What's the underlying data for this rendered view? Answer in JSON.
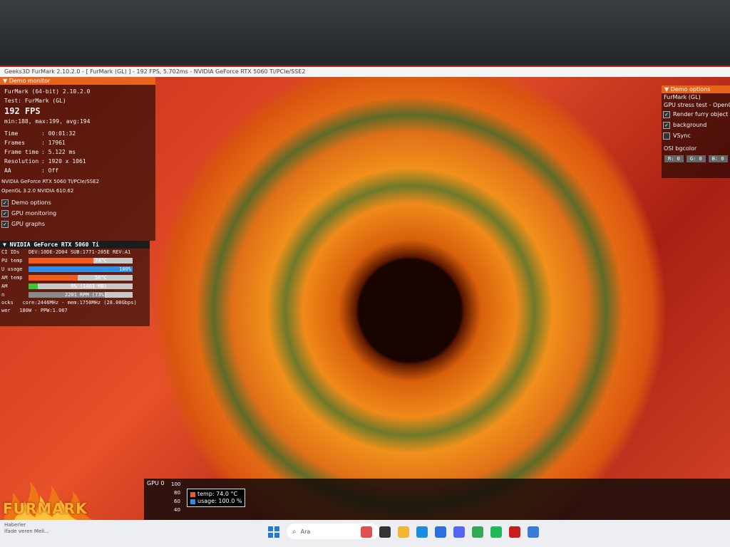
{
  "window": {
    "title": "Geeks3D FurMark 2.10.2.0 - [ FurMark (GL) ] - 192 FPS, 5.702ms - NVIDIA GeForce RTX 5060 Ti/PCIe/SSE2"
  },
  "demo_monitor": {
    "header": "Demo monitor",
    "app": "FurMark (64-bit) 2.10.2.0",
    "test": "Test: FurMark (GL)",
    "fps": "192 FPS",
    "fps_stats": "min:188, max:199, avg:194",
    "stats": [
      {
        "label": "Time",
        "value": ": 00:01:32"
      },
      {
        "label": "Frames",
        "value": ": 17961"
      },
      {
        "label": "Frame time",
        "value": ": 5.122 ms"
      },
      {
        "label": "Resolution",
        "value": ": 1920 x 1061"
      },
      {
        "label": "AA",
        "value": ": Off"
      }
    ],
    "renderer": "NVIDIA GeForce RTX 5060 Ti/PCIe/SSE2",
    "opengl": "OpenGL 3.2.0 NVIDIA 610.62",
    "options": [
      {
        "label": "Demo options",
        "checked": true
      },
      {
        "label": "GPU monitoring",
        "checked": true
      },
      {
        "label": "GPU graphs",
        "checked": true
      }
    ]
  },
  "gpu_monitor": {
    "header": "NVIDIA GeForce RTX 5060 Ti",
    "pci": "DEV:10DE-2D04 SUB:1771-205E REV:A1",
    "pci_label": "CI IDs",
    "rows": [
      {
        "label": "PU temp",
        "text": "74°C",
        "fraction": 0.62,
        "color": "#f05a1e"
      },
      {
        "label": "U usage",
        "text": "100%",
        "fraction": 1.0,
        "color": "#2f8fe6"
      },
      {
        "label": "AM temp",
        "text": "56°C",
        "fraction": 0.47,
        "color": "#f05a1e"
      },
      {
        "label": "AM",
        "text": "9% (1461 MB)",
        "fraction": 0.09,
        "color": "#3cc43c"
      },
      {
        "label": "n",
        "text": "2201 RPM (73%)",
        "fraction": 0.73,
        "color": "#8a8a8a"
      }
    ],
    "clocks_label": "ocks",
    "clocks": "core:2446MHz - mem:1750MHz (28.00Gbps)",
    "power_label": "wer",
    "power": "180W - PPW:1.067"
  },
  "demo_options": {
    "header": "Demo options",
    "api": "FurMark (GL)",
    "subtitle": "GPU stress test - OpenGL 3",
    "checks": [
      {
        "label": "Render furry object",
        "checked": true
      },
      {
        "label": "background",
        "checked": true
      },
      {
        "label": "VSync",
        "checked": false
      }
    ],
    "osi_label": "OSI bgcolor",
    "rgb": [
      "R: 0",
      "G: 0",
      "B: 0"
    ]
  },
  "logo": {
    "text": "FURMARK"
  },
  "graph": {
    "title": "GPU 0",
    "axis": [
      "100",
      "80",
      "60",
      "40"
    ],
    "legend": [
      {
        "label": "temp: 74.0 °C",
        "color": "#f05a1e"
      },
      {
        "label": "usage: 100.0 %",
        "color": "#2f8fe6"
      }
    ]
  },
  "taskbar": {
    "news_title": "Haberler",
    "news_sub": "İfade veren Meli...",
    "search_placeholder": "Ara",
    "icons": [
      {
        "name": "widgets-icon",
        "color": "#e05050"
      },
      {
        "name": "task-view-icon",
        "color": "#333333"
      },
      {
        "name": "file-explorer-icon",
        "color": "#f2b632"
      },
      {
        "name": "edge-icon",
        "color": "#1c8be0"
      },
      {
        "name": "store-icon",
        "color": "#2d6fe0"
      },
      {
        "name": "discord-icon",
        "color": "#5865f2"
      },
      {
        "name": "chrome-icon",
        "color": "#34a853"
      },
      {
        "name": "spotify-icon",
        "color": "#1db954"
      },
      {
        "name": "furmark-icon",
        "color": "#c81e1e"
      },
      {
        "name": "app-icon",
        "color": "#3a7bd5"
      }
    ]
  }
}
